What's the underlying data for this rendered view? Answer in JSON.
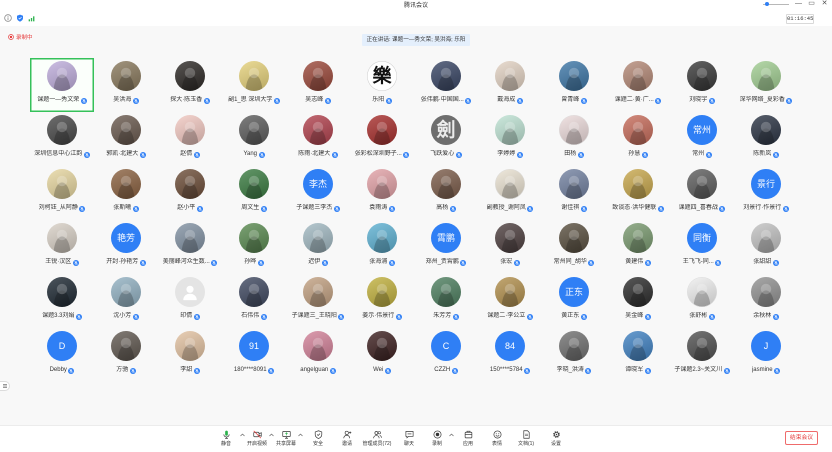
{
  "window": {
    "title": "腾讯会议",
    "timer": "01:16:45"
  },
  "status": {
    "recording_label": "录制中",
    "speaking_banner": "正在讲话: 课题一—秀文荣; 吴洪海; 乐阳"
  },
  "colors": {
    "accent": "#2f7ff5",
    "speaking_border": "#35c15a",
    "recording": "#e5393a",
    "end_meeting": "#e5393a",
    "mic_on": "#2bb24c"
  },
  "gallery": {
    "participants": [
      {
        "name": "课题一—秀文荣",
        "avatar_color": "#bfaedc",
        "speaking": true
      },
      {
        "name": "吴洪海",
        "avatar_color": "#8a7a5e"
      },
      {
        "name": "探大·陈玉香",
        "avatar_color": "#2e2a27"
      },
      {
        "name": "副1_思 深圳大学",
        "avatar_color": "#e6d27c"
      },
      {
        "name": "吴志峰",
        "avatar_color": "#9c4a3c"
      },
      {
        "name": "乐阳",
        "avatar_color": "#ffffff",
        "avatar_text": "樂",
        "avatar_text_color": "#111111"
      },
      {
        "name": "张伟鹏·中国国...",
        "avatar_color": "#3a4766"
      },
      {
        "name": "戴海成",
        "avatar_color": "#e3d3c4"
      },
      {
        "name": "曾青峰",
        "avatar_color": "#3f78a8"
      },
      {
        "name": "课题二·黄·广...",
        "avatar_color": "#b58a78"
      },
      {
        "name": "刘晓宇",
        "avatar_color": "#3b3b3b"
      },
      {
        "name": "深华网络_夏彩香",
        "avatar_color": "#a3cf94"
      },
      {
        "name": "深圳信息中心江韵",
        "avatar_color": "#4a4a4a"
      },
      {
        "name": "郭凯·北建大",
        "avatar_color": "#6b5b50"
      },
      {
        "name": "赵倩",
        "avatar_color": "#f2c9c2"
      },
      {
        "name": "Yang",
        "avatar_color": "#5e5e5e"
      },
      {
        "name": "陈雨·北建大",
        "avatar_color": "#b2434f"
      },
      {
        "name": "张彩松深圳野子...",
        "avatar_color": "#a8302e"
      },
      {
        "name": "飞跃爱心",
        "avatar_color": "#6e6e6e",
        "avatar_text": "劍",
        "avatar_text_color": "#ececec"
      },
      {
        "name": "李婷婷",
        "avatar_color": "#bfe3d4"
      },
      {
        "name": "田杨",
        "avatar_color": "#eddcdc"
      },
      {
        "name": "孙慧",
        "avatar_color": "#c76d5c"
      },
      {
        "name": "常州",
        "avatar_color": "#2f7ff5",
        "avatar_text": "常州"
      },
      {
        "name": "陈新岚",
        "avatar_color": "#2d3646"
      },
      {
        "name": "刘柯钰_从阿静",
        "avatar_color": "#e7d7a1"
      },
      {
        "name": "张斯曦",
        "avatar_color": "#8c6342"
      },
      {
        "name": "赵小平",
        "avatar_color": "#6e4f3a"
      },
      {
        "name": "周文生",
        "avatar_color": "#3c7d43"
      },
      {
        "name": "子课题三李杰",
        "avatar_color": "#2f7ff5",
        "avatar_text": "李杰"
      },
      {
        "name": "袁雨涛",
        "avatar_color": "#e3a3a8"
      },
      {
        "name": "高杨",
        "avatar_color": "#7d5e4c"
      },
      {
        "name": "副教授_谢阿凤",
        "avatar_color": "#ebe3d3"
      },
      {
        "name": "谢佳祺",
        "avatar_color": "#7483a2"
      },
      {
        "name": "致谈态·洪华健联",
        "avatar_color": "#c9a94f"
      },
      {
        "name": "课题四_喜春战",
        "avatar_color": "#5f5f5f"
      },
      {
        "name": "刘景行·作景行",
        "avatar_color": "#2f7ff5",
        "avatar_text": "景行"
      },
      {
        "name": "王锐·汉区",
        "avatar_color": "#d9d1c7"
      },
      {
        "name": "开封·孙艳芳",
        "avatar_color": "#2f7ff5",
        "avatar_text": "艳芳"
      },
      {
        "name": "美丽峰河众生数...",
        "avatar_color": "#8393a4"
      },
      {
        "name": "孙晔",
        "avatar_color": "#5b8b52"
      },
      {
        "name": "迟伊",
        "avatar_color": "#a3bac3"
      },
      {
        "name": "张海浦",
        "avatar_color": "#5fb2d3"
      },
      {
        "name": "郑州_贾霄鹏",
        "avatar_color": "#2f7ff5",
        "avatar_text": "霄鹏"
      },
      {
        "name": "张宏",
        "avatar_color": "#4f4141"
      },
      {
        "name": "常州同_胡华",
        "avatar_color": "#5b5141"
      },
      {
        "name": "黄建伟",
        "avatar_color": "#7b9b71"
      },
      {
        "name": "王飞飞-同...",
        "avatar_color": "#2f7ff5",
        "avatar_text": "同衡"
      },
      {
        "name": "张甜甜",
        "avatar_color": "#c3c3c3"
      },
      {
        "name": "课题3.3刘娟",
        "avatar_color": "#1f2a34"
      },
      {
        "name": "沈小芳",
        "avatar_color": "#93b2c3"
      },
      {
        "name": "印倩",
        "avatar_color": "#e4e4e4",
        "avatar_icon": "default-user-icon"
      },
      {
        "name": "石伟伟",
        "avatar_color": "#414a62"
      },
      {
        "name": "子课题三_王晓阳",
        "avatar_color": "#c3a283"
      },
      {
        "name": "姜示·伟景行",
        "avatar_color": "#c2b240"
      },
      {
        "name": "朱芳芳",
        "avatar_color": "#4f8061"
      },
      {
        "name": "课题二·李公立",
        "avatar_color": "#b3914f"
      },
      {
        "name": "黄正东",
        "avatar_color": "#2f7ff5",
        "avatar_text": "正东"
      },
      {
        "name": "吴金峰",
        "avatar_color": "#2e2e2e"
      },
      {
        "name": "张舒彬",
        "avatar_color": "#f0f0f0"
      },
      {
        "name": "余秋林",
        "avatar_color": "#939393"
      },
      {
        "name": "Debby",
        "avatar_color": "#2f7ff5",
        "avatar_text": "D"
      },
      {
        "name": "方驰",
        "avatar_color": "#625a52"
      },
      {
        "name": "李甜",
        "avatar_color": "#e3c3a3"
      },
      {
        "name": "180****8091",
        "avatar_color": "#2f7ff5",
        "avatar_text": "91"
      },
      {
        "name": "angelguan",
        "avatar_color": "#d3839a"
      },
      {
        "name": "Wei",
        "avatar_color": "#3f2222"
      },
      {
        "name": "CZZH",
        "avatar_color": "#2f7ff5",
        "avatar_text": "C"
      },
      {
        "name": "150****5784",
        "avatar_color": "#2f7ff5",
        "avatar_text": "84"
      },
      {
        "name": "李晓_洪涛",
        "avatar_color": "#727272"
      },
      {
        "name": "谭晓军",
        "avatar_color": "#4283c3"
      },
      {
        "name": "子课题2.3~关文川",
        "avatar_color": "#525252"
      },
      {
        "name": "jasmine",
        "avatar_color": "#2f7ff5",
        "avatar_text": "J"
      }
    ]
  },
  "toolbar": {
    "items": [
      {
        "label": "静音",
        "icon": "mic-icon"
      },
      {
        "label": "开启视频",
        "icon": "video-off-icon"
      },
      {
        "label": "共享屏幕",
        "icon": "share-screen-icon"
      },
      {
        "label": "安全",
        "icon": "shield-icon"
      },
      {
        "label": "邀请",
        "icon": "invite-icon"
      },
      {
        "label": "管理成员(72)",
        "icon": "members-icon"
      },
      {
        "label": "聊天",
        "icon": "chat-icon"
      },
      {
        "label": "录制",
        "icon": "record-icon"
      },
      {
        "label": "应用",
        "icon": "apps-icon"
      },
      {
        "label": "表情",
        "icon": "emoji-icon"
      },
      {
        "label": "文档(1)",
        "icon": "document-icon"
      },
      {
        "label": "设置",
        "icon": "gear-icon"
      }
    ],
    "end_meeting": "结束会议"
  }
}
